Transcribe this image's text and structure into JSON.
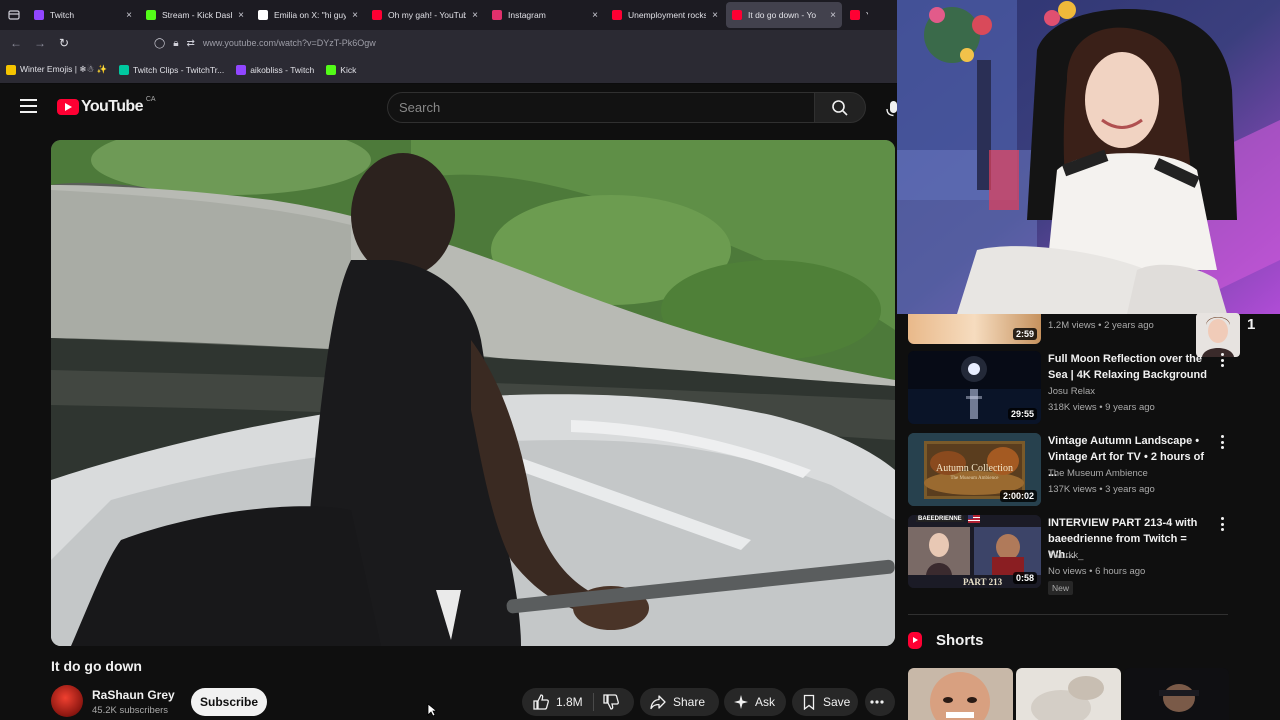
{
  "browser": {
    "tabs": [
      {
        "label": "Twitch",
        "color": "#9146ff",
        "active": false,
        "width": 110
      },
      {
        "label": "Stream - Kick Dash",
        "color": "#53fc18",
        "active": false,
        "width": 110
      },
      {
        "label": "Emilia on X: \"hi guys, th",
        "color": "#ffffff",
        "active": false,
        "width": 112
      },
      {
        "label": "Oh my gah! - YouTube",
        "color": "#ff0033",
        "active": false,
        "width": 118
      },
      {
        "label": "Instagram",
        "color": "#e1306c",
        "active": false,
        "width": 118
      },
      {
        "label": "Unemployment rocks #",
        "color": "#ff0033",
        "active": false,
        "width": 118
      },
      {
        "label": "It do go down - Yo",
        "color": "#ff0033",
        "active": true,
        "width": 116
      },
      {
        "label": "Yo",
        "color": "#ff0033",
        "active": false,
        "width": 30
      }
    ],
    "url": "www.youtube.com/watch?v=DYzT-Pk6Ogw",
    "bookmarks": [
      {
        "label": "Winter Emojis | ❄☃ ✨",
        "color": "#f5c400"
      },
      {
        "label": "Twitch Clips - TwitchTr...",
        "color": "#00c8a0"
      },
      {
        "label": "aikobliss - Twitch",
        "color": "#9146ff"
      },
      {
        "label": "Kick",
        "color": "#53fc18"
      }
    ]
  },
  "header": {
    "logo_text": "YouTube",
    "country": "CA",
    "search_placeholder": "Search"
  },
  "video": {
    "title": "It do go down",
    "channel": "RaShaun Grey",
    "subscribers": "45.2K subscribers",
    "subscribe_label": "Subscribe",
    "likes": "1.8M",
    "share_label": "Share",
    "ask_label": "Ask",
    "save_label": "Save"
  },
  "sidebar": {
    "top_item": {
      "meta": "1.2M views • 2 years ago",
      "duration": "2:59"
    },
    "floating_rank": "1",
    "items": [
      {
        "title_line1": "Full Moon Reflection over the",
        "title_line2": "Sea | 4K Relaxing Background",
        "channel": "Josu Relax",
        "meta": "318K views • 9 years ago",
        "duration": "29:55"
      },
      {
        "title_line1": "Vintage Autumn Landscape •",
        "title_line2": "Vintage Art for TV • 2 hours of ...",
        "channel": "The Museum Ambience",
        "meta": "137K views • 3 years ago",
        "duration": "2:00:02",
        "thumb_text": "Autumn Collection",
        "thumb_sub": "The Museum Ambience"
      },
      {
        "title_line1": "INTERVIEW PART 213-4 with",
        "title_line2": "baeedrienne from Twitch = Wh...",
        "channel": "Twurkk_",
        "meta": "No views • 6 hours ago",
        "duration": "0:58",
        "badge": "New",
        "thumb_handle": "BAEEDRIENNE",
        "thumb_part": "PART 213"
      }
    ],
    "shorts_label": "Shorts"
  }
}
